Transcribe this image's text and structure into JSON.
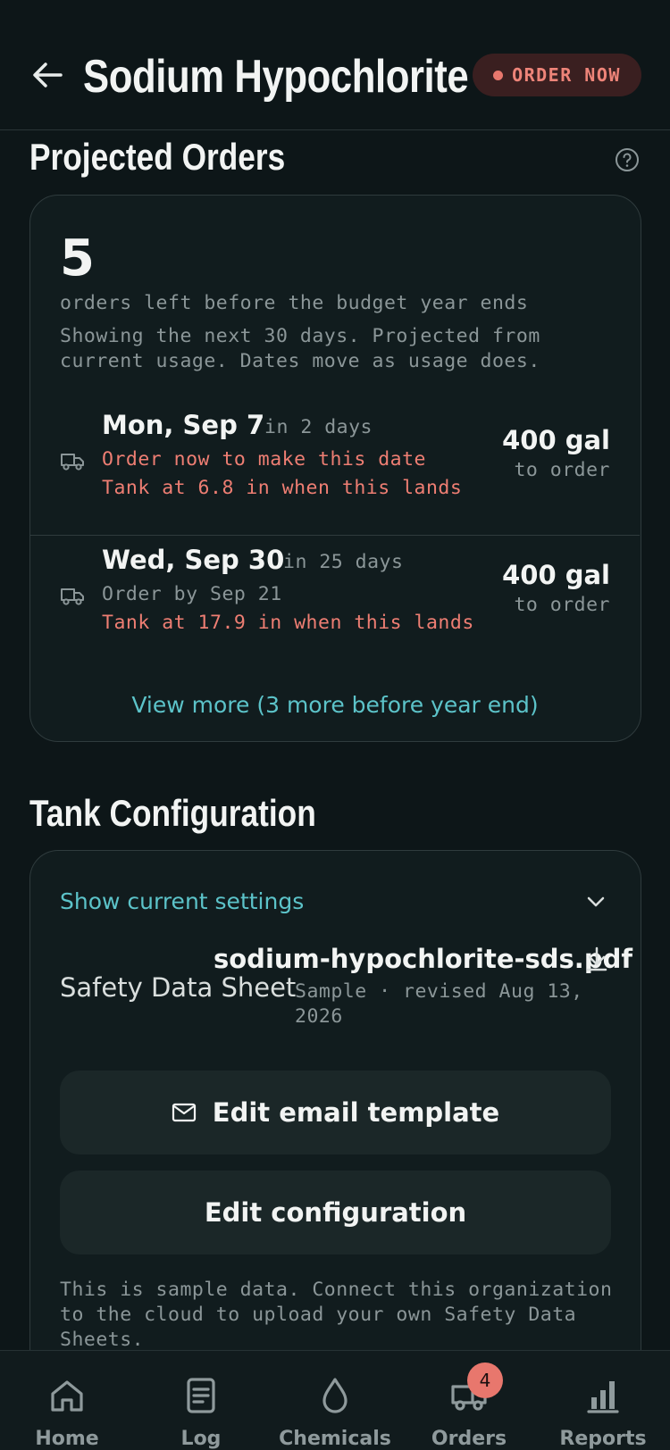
{
  "header": {
    "title": "Sodium Hypochlorite",
    "order_now_label": "ORDER NOW",
    "status_color": "#e8776d"
  },
  "projected": {
    "section_title": "Projected Orders",
    "count": "5",
    "count_caption": "orders left before the budget year ends",
    "description": "Showing the next 30 days. Projected from current usage. Dates move as usage does.",
    "orders": [
      {
        "date": "Mon, Sep 7",
        "relative": "in 2 days",
        "line1": "Order now to make this date",
        "line2": "Tank at 6.8 in when this lands",
        "quantity": "400 gal",
        "quantity_caption": "to order"
      },
      {
        "date": "Wed, Sep 30",
        "relative": "in 25 days",
        "line1": "Order by Sep 21",
        "line2": "Tank at 17.9 in when this lands",
        "quantity": "400 gal",
        "quantity_caption": "to order"
      }
    ],
    "view_more": "View more (3 more before year end)"
  },
  "tank": {
    "section_title": "Tank Configuration",
    "show_settings": "Show current settings",
    "sds_label": "Safety Data Sheet",
    "sds_file": "sodium-hypochlorite-sds.pdf",
    "sds_meta": "Sample · revised Aug 13, 2026",
    "edit_email_label": "Edit email template",
    "edit_config_label": "Edit configuration",
    "note": "This is sample data. Connect this organization to the cloud to upload your own Safety Data Sheets."
  },
  "tabs": [
    {
      "label": "Home",
      "icon": "home-icon"
    },
    {
      "label": "Log",
      "icon": "log-icon"
    },
    {
      "label": "Chemicals",
      "icon": "droplet-icon"
    },
    {
      "label": "Orders",
      "icon": "truck-icon",
      "badge": "4"
    },
    {
      "label": "Reports",
      "icon": "bar-chart-icon"
    }
  ],
  "colors": {
    "background": "#0d1618",
    "card": "#111c1e",
    "accent": "#5cc3c9",
    "alert": "#ee7e73"
  }
}
